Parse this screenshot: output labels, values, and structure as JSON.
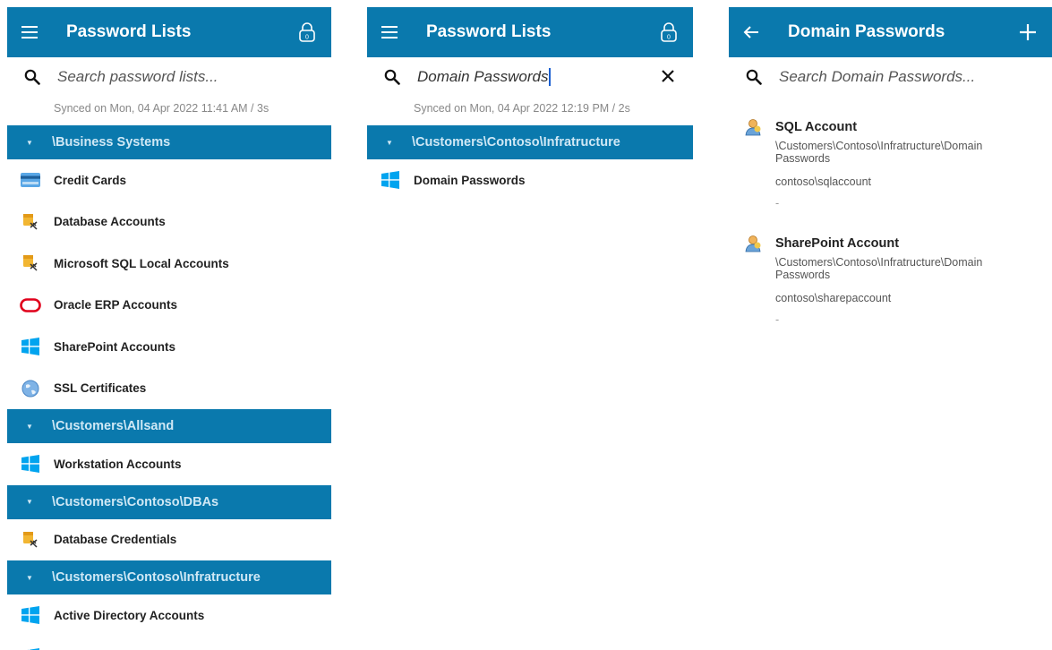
{
  "colors": {
    "accent": "#0a79ad",
    "group_text": "#cfe8f5"
  },
  "panel1": {
    "header": {
      "title": "Password Lists",
      "menu_icon": "hamburger-icon",
      "lock_icon": "lock-icon",
      "lock_count": "0"
    },
    "search": {
      "placeholder": "Search password lists..."
    },
    "sync": "Synced on Mon, 04 Apr 2022 11:41 AM / 3s",
    "groups": [
      {
        "name": "\\Business Systems",
        "items": [
          {
            "label": "Credit Cards",
            "icon": "credit-card-icon"
          },
          {
            "label": "Database Accounts",
            "icon": "database-key-icon"
          },
          {
            "label": "Microsoft SQL Local Accounts",
            "icon": "database-key-icon"
          },
          {
            "label": "Oracle ERP Accounts",
            "icon": "oracle-icon"
          },
          {
            "label": "SharePoint Accounts",
            "icon": "windows-icon"
          },
          {
            "label": "SSL Certificates",
            "icon": "globe-icon"
          }
        ]
      },
      {
        "name": "\\Customers\\Allsand",
        "items": [
          {
            "label": "Workstation Accounts",
            "icon": "windows-icon"
          }
        ]
      },
      {
        "name": "\\Customers\\Contoso\\DBAs",
        "items": [
          {
            "label": "Database Credentials",
            "icon": "database-key-icon"
          }
        ]
      },
      {
        "name": "\\Customers\\Contoso\\Infratructure",
        "items": [
          {
            "label": "Active Directory Accounts",
            "icon": "windows-icon"
          }
        ]
      }
    ]
  },
  "panel2": {
    "header": {
      "title": "Password Lists",
      "menu_icon": "hamburger-icon",
      "lock_icon": "lock-icon",
      "lock_count": "0"
    },
    "search": {
      "value": "Domain Passwords"
    },
    "sync": "Synced on Mon, 04 Apr 2022 12:19 PM / 2s",
    "group": "\\Customers\\Contoso\\Infratructure",
    "item": {
      "label": "Domain Passwords",
      "icon": "windows-icon"
    }
  },
  "panel3": {
    "header": {
      "title": "Domain Passwords",
      "back_icon": "back-arrow-icon",
      "add_icon": "plus-icon"
    },
    "search": {
      "placeholder": "Search Domain Passwords..."
    },
    "entries": [
      {
        "title": "SQL Account",
        "path": "\\Customers\\Contoso\\Infratructure\\Domain Passwords",
        "username": "contoso\\sqlaccount",
        "extra": "-",
        "icon": "user-account-icon"
      },
      {
        "title": "SharePoint Account",
        "path": "\\Customers\\Contoso\\Infratructure\\Domain Passwords",
        "username": "contoso\\sharepaccount",
        "extra": "-",
        "icon": "user-account-icon"
      }
    ]
  }
}
